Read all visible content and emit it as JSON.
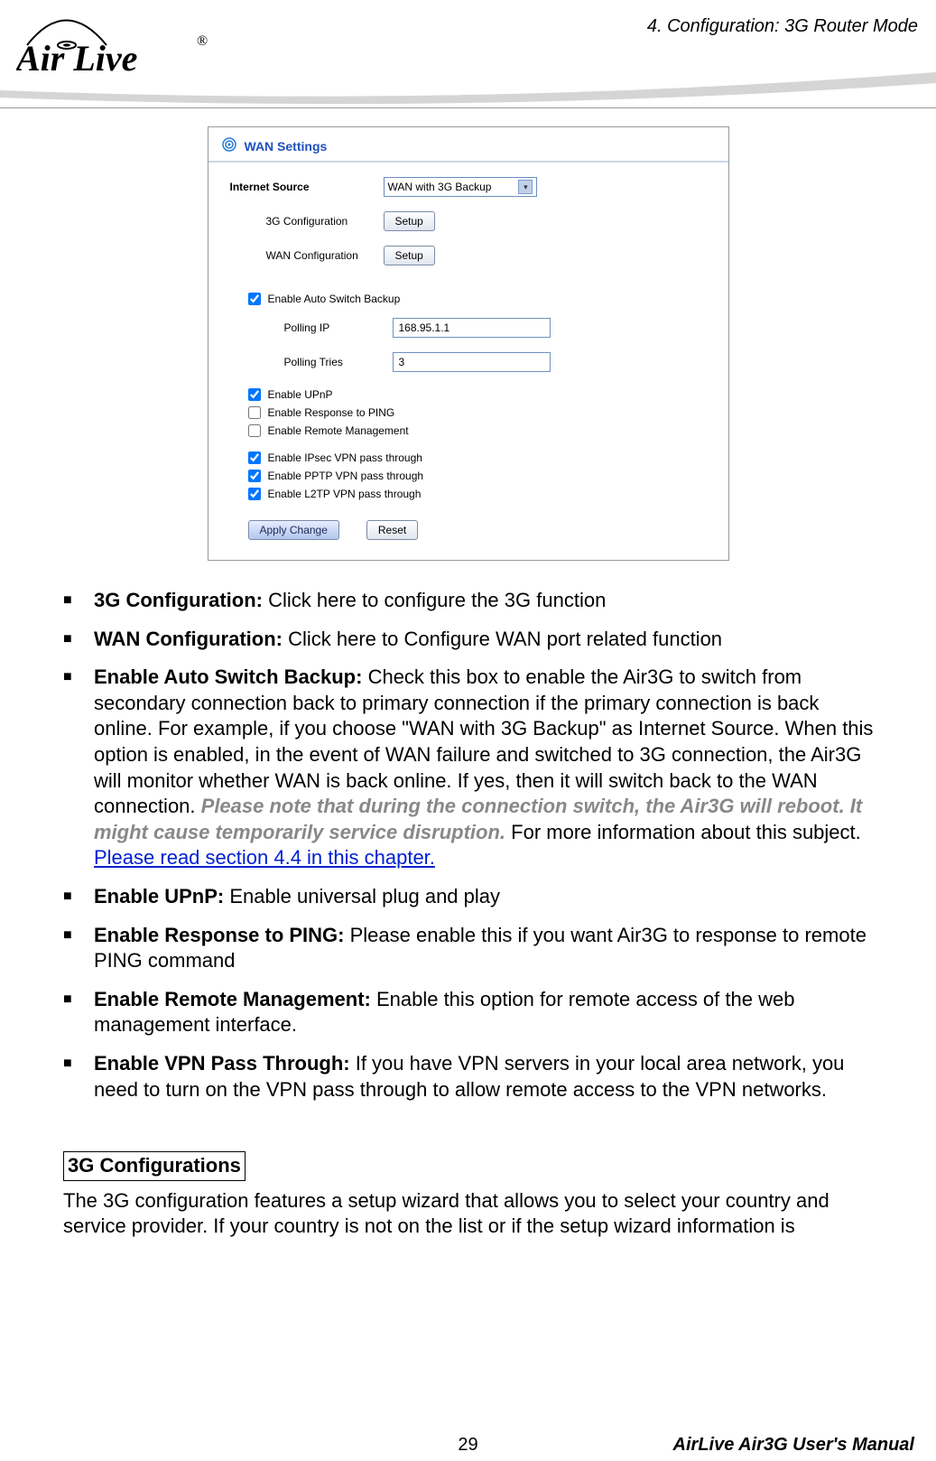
{
  "header": {
    "chapter_title": "4. Configuration: 3G Router Mode",
    "logo_text": "Air Live",
    "logo_r": "®"
  },
  "screenshot": {
    "panel_title": "WAN Settings",
    "rows": {
      "internet_source_label": "Internet Source",
      "internet_source_value": "WAN with 3G Backup",
      "g3_config_label": "3G Configuration",
      "g3_config_btn": "Setup",
      "wan_config_label": "WAN Configuration",
      "wan_config_btn": "Setup",
      "auto_switch_label": "Enable Auto Switch Backup",
      "polling_ip_label": "Polling IP",
      "polling_ip_value": "168.95.1.1",
      "polling_tries_label": "Polling Tries",
      "polling_tries_value": "3",
      "upnp_label": "Enable UPnP",
      "ping_label": "Enable Response to PING",
      "remote_mgmt_label": "Enable Remote Management",
      "ipsec_label": "Enable IPsec VPN pass through",
      "pptp_label": "Enable PPTP VPN pass through",
      "l2tp_label": "Enable L2TP VPN pass through",
      "apply_btn": "Apply Change",
      "reset_btn": "Reset"
    },
    "checked": {
      "auto_switch": true,
      "upnp": true,
      "ping": false,
      "remote_mgmt": false,
      "ipsec": true,
      "pptp": true,
      "l2tp": true
    }
  },
  "bullets": {
    "b1_bold": "3G Configuration: ",
    "b1_text": "Click here to configure the 3G function",
    "b2_bold": "WAN Configuration: ",
    "b2_text": "Click here to Configure WAN port related function",
    "b3_bold": "Enable Auto Switch Backup:",
    "b3_text1": "   Check this box to enable the Air3G to switch from secondary connection back to primary connection if the primary connection is back online.    For example, if you choose \"WAN with 3G Backup\" as Internet Source. When this option is enabled, in the event of WAN failure and switched to 3G connection, the Air3G will monitor whether WAN is back online.    If yes, then it will switch back to the WAN connection.    ",
    "b3_italic": "Please note that during the connection switch, the Air3G will reboot.   It might cause temporarily service disruption.",
    "b3_text2": "    For more information about this subject.    ",
    "b3_link": "Please read section 4.4 in this chapter.",
    "b4_bold": "Enable UPnP:",
    "b4_text": "    Enable universal plug and play",
    "b5_bold": "Enable Response to PING:",
    "b5_text": "    Please enable this if you want Air3G to response to remote PING command",
    "b6_bold": "Enable Remote Management:",
    "b6_text": "    Enable this option for remote access of the web management interface.",
    "b7_bold": "Enable VPN Pass Through:",
    "b7_text": "    If you have VPN servers in your local area network, you need to turn on the VPN pass through to allow remote access to the VPN networks."
  },
  "section": {
    "heading": "3G Configurations",
    "para": "The 3G configuration features a setup wizard that allows you to select your country and service provider.    If your country is not on the list or if the setup wizard information is"
  },
  "footer": {
    "page": "29",
    "manual": "AirLive Air3G User's Manual"
  }
}
